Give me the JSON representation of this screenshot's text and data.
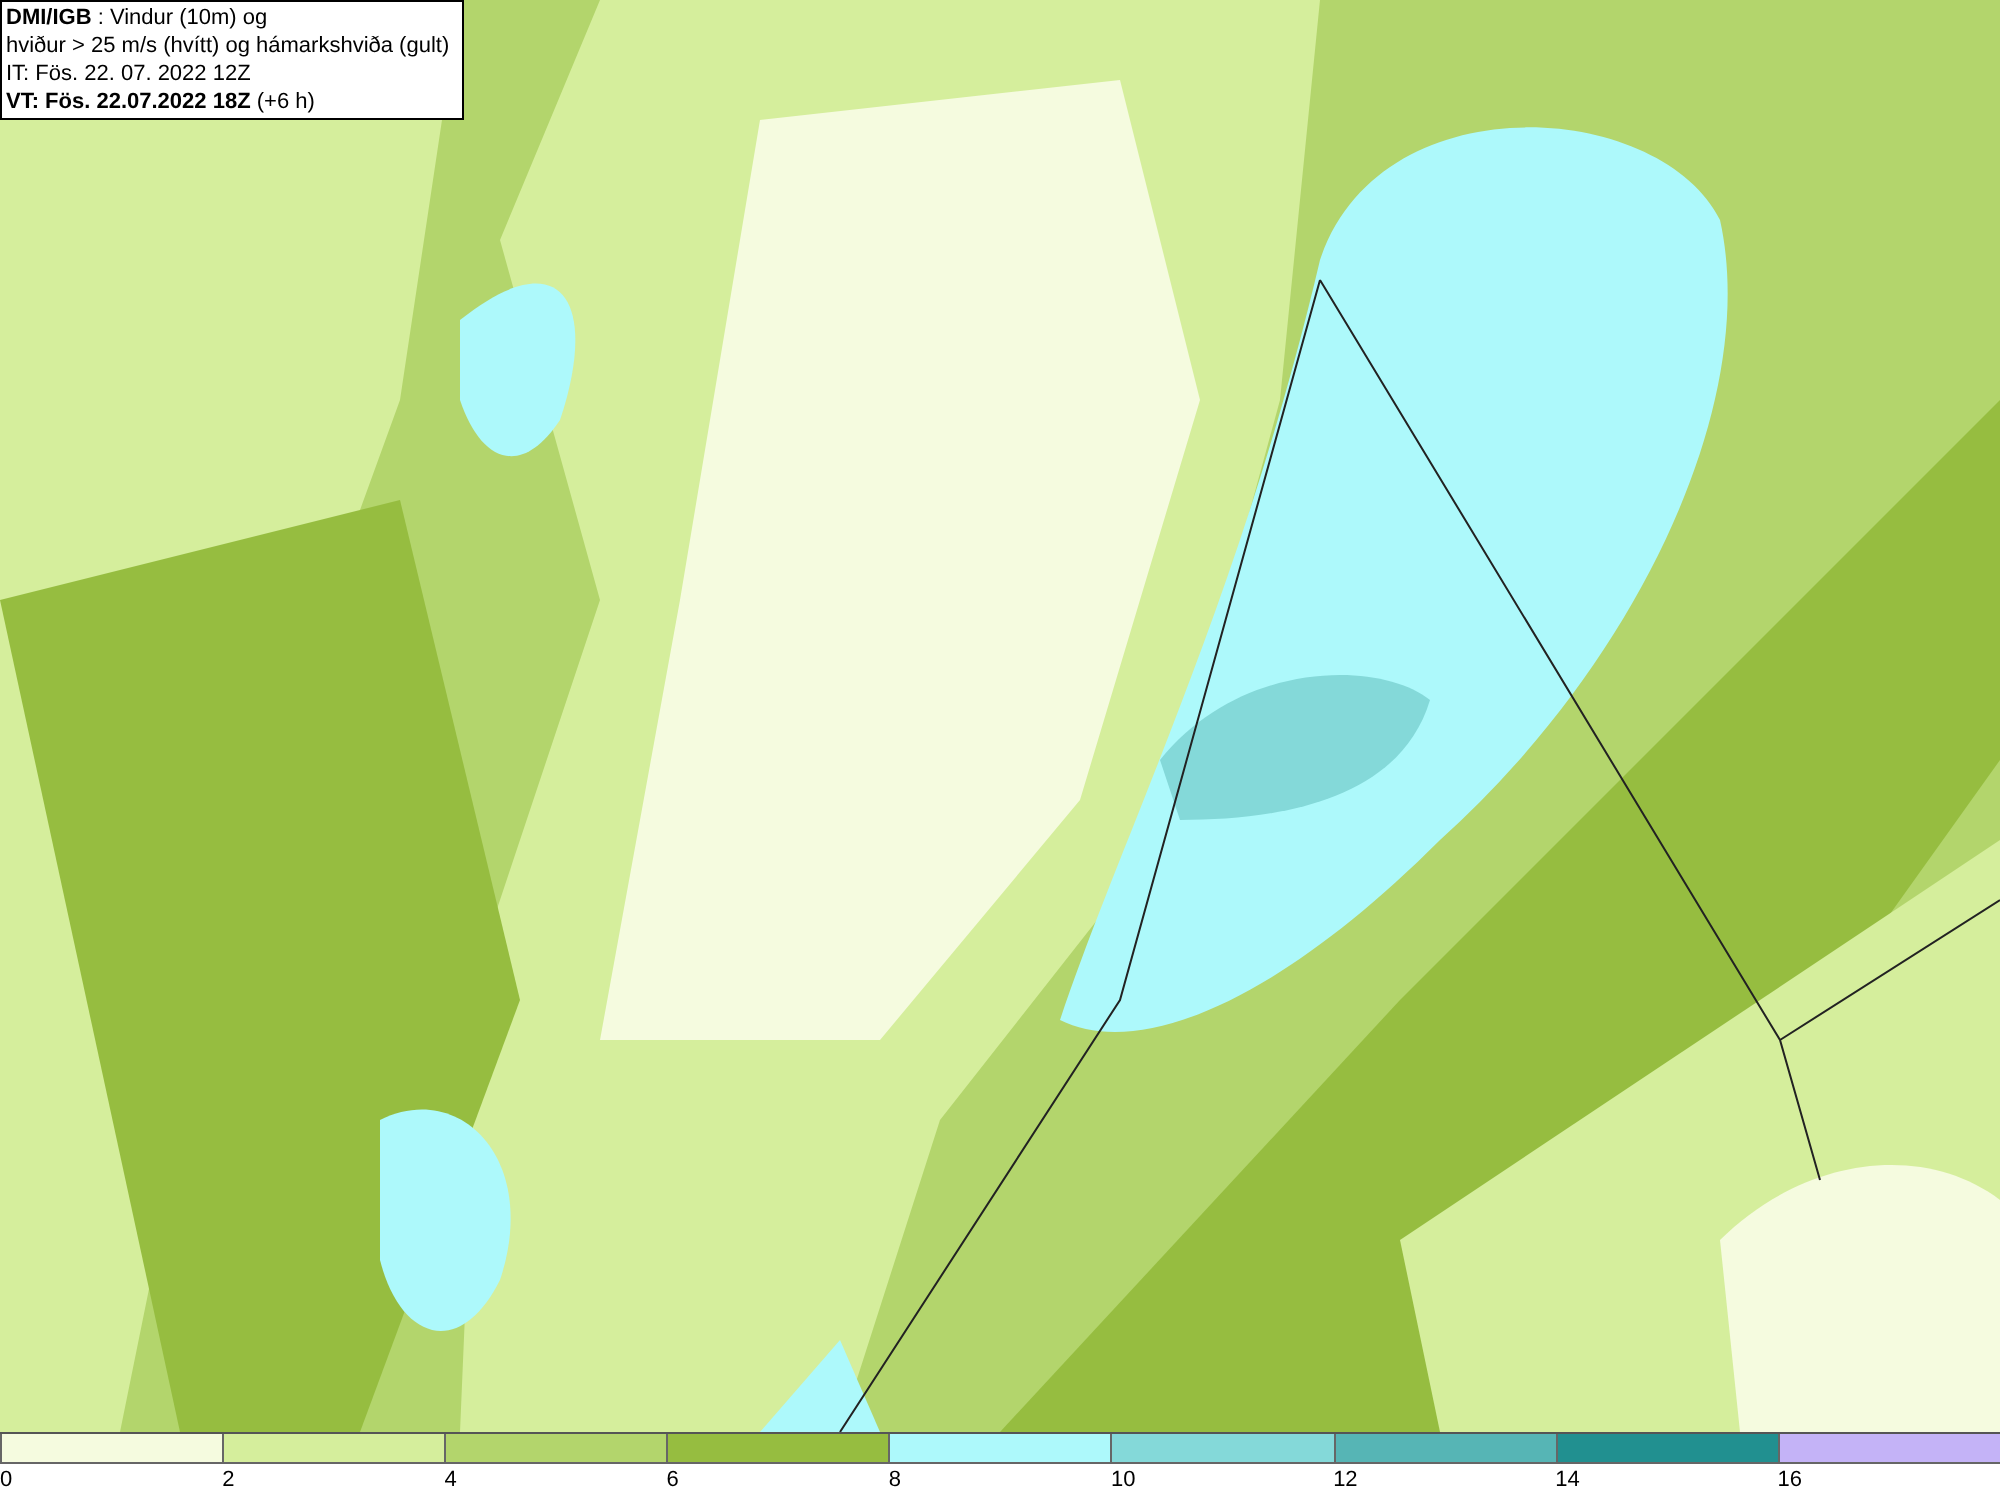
{
  "title_box": {
    "lines": [
      "**DMI/IGB** : Vindur (10m) og",
      "hviður > 25 m/s (hvítt) og hámarkshviða (gult)",
      "IT: Fös. 22. 07. 2022 12Z",
      "**VT: Fös. 22.07.2022 18Z** (+6 h)"
    ]
  },
  "legend": {
    "swatches": [
      {
        "color": "#f5fbdf",
        "label": "0"
      },
      {
        "color": "#d5ee9c",
        "label": "2"
      },
      {
        "color": "#b3d56c",
        "label": "4"
      },
      {
        "color": "#96bd40",
        "label": "6"
      },
      {
        "color": "#adf9fb",
        "label": "8"
      },
      {
        "color": "#84d9d9",
        "label": "10"
      },
      {
        "color": "#56b5b5",
        "label": "12"
      },
      {
        "color": "#219090",
        "label": "14"
      },
      {
        "color": "#c4b3f7",
        "label": "16"
      }
    ]
  }
}
